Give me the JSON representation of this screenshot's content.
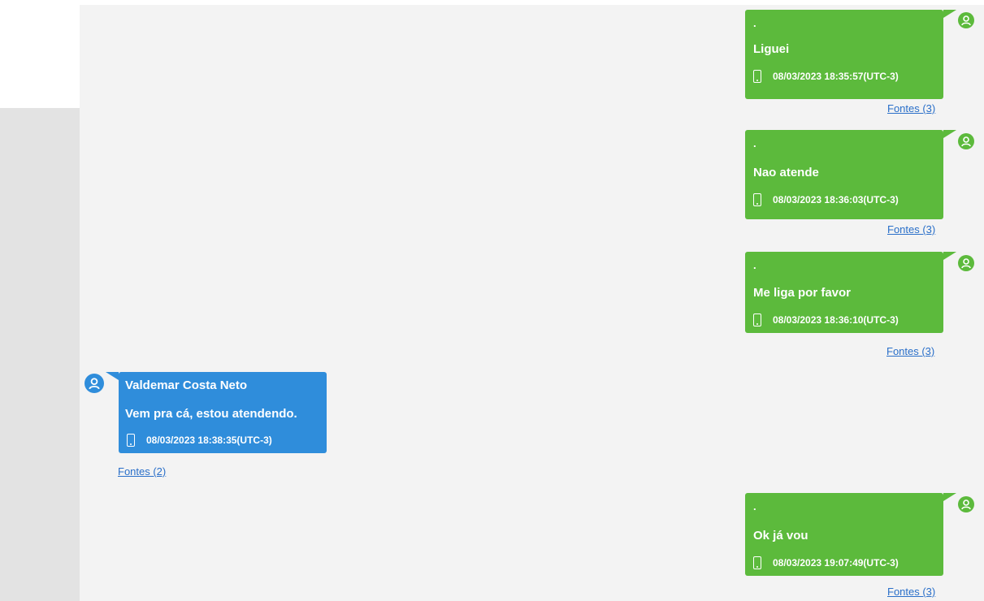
{
  "colors": {
    "outgoing_bubble": "#5cba3c",
    "incoming_bubble": "#2f8ddb",
    "link": "#2a6fc9",
    "pane_background": "#f3f3f3"
  },
  "messages": [
    {
      "direction": "outgoing",
      "sender": ".",
      "text": "Liguei",
      "timestamp": "08/03/2023 18:35:57(UTC-3)",
      "sources_link": "Fontes (3)",
      "avatar_icon": "user-icon",
      "device_icon": "phone-icon"
    },
    {
      "direction": "outgoing",
      "sender": ".",
      "text": "Nao atende",
      "timestamp": "08/03/2023 18:36:03(UTC-3)",
      "sources_link": "Fontes (3)",
      "avatar_icon": "user-icon",
      "device_icon": "phone-icon"
    },
    {
      "direction": "outgoing",
      "sender": ".",
      "text": "Me liga por favor",
      "timestamp": "08/03/2023 18:36:10(UTC-3)",
      "sources_link": "Fontes (3)",
      "avatar_icon": "user-icon",
      "device_icon": "phone-icon"
    },
    {
      "direction": "incoming",
      "sender": "Valdemar Costa Neto",
      "text": "Vem pra cá, estou atendendo.",
      "timestamp": "08/03/2023 18:38:35(UTC-3)",
      "sources_link": "Fontes (2)",
      "avatar_icon": "user-icon",
      "device_icon": "phone-icon"
    },
    {
      "direction": "outgoing",
      "sender": ".",
      "text": "Ok já vou",
      "timestamp": "08/03/2023 19:07:49(UTC-3)",
      "sources_link": "Fontes (3)",
      "avatar_icon": "user-icon",
      "device_icon": "phone-icon"
    }
  ]
}
